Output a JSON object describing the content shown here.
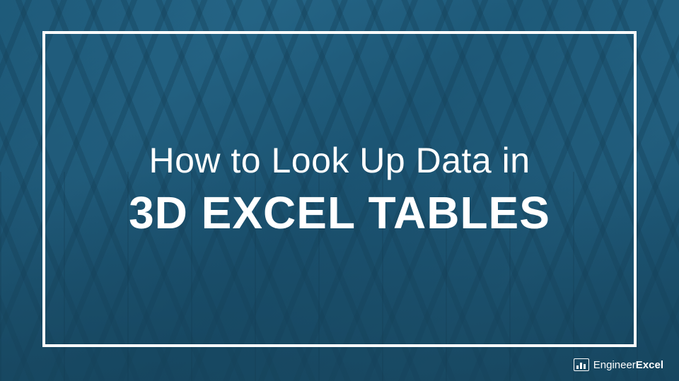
{
  "title": {
    "line1": "How to Look Up Data in",
    "line2": "3D EXCEL TABLES"
  },
  "brand": {
    "name_part1": "Engineer",
    "name_part2": "Excel"
  }
}
